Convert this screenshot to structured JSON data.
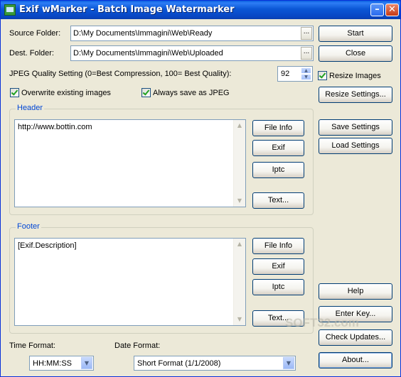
{
  "window": {
    "title": "Exif wMarker - Batch Image Watermarker",
    "minimize_glyph": "–",
    "close_glyph": "✕"
  },
  "source": {
    "label": "Source Folder:",
    "value": "D:\\My Documents\\Immagini\\Web\\Ready",
    "browse": "..."
  },
  "dest": {
    "label": "Dest. Folder:",
    "value": "D:\\My Documents\\Immagini\\Web\\Uploaded",
    "browse": "..."
  },
  "quality": {
    "label": "JPEG Quality Setting (0=Best Compression, 100= Best Quality):",
    "value": "92",
    "up": "▲",
    "down": "▼"
  },
  "options": {
    "overwrite": "Overwrite existing images",
    "always_jpeg": "Always save as JPEG",
    "resize": "Resize Images"
  },
  "header": {
    "title": "Header",
    "text": "http://www.bottin.com",
    "buttons": {
      "file_info": "File Info",
      "exif": "Exif",
      "iptc": "Iptc",
      "text": "Text..."
    }
  },
  "footer": {
    "title": "Footer",
    "text": "[Exif.Description]",
    "buttons": {
      "file_info": "File Info",
      "exif": "Exif",
      "iptc": "Iptc",
      "text": "Text..."
    }
  },
  "scroll": {
    "up": "▲",
    "down": "▼"
  },
  "time_format": {
    "label": "Time Format:",
    "value": "HH:MM:SS",
    "arrow": "▼"
  },
  "date_format": {
    "label": "Date Format:",
    "value": "Short Format (1/1/2008)",
    "arrow": "▼"
  },
  "side_buttons": {
    "start": "Start",
    "close": "Close",
    "resize_settings": "Resize Settings...",
    "save_settings": "Save Settings",
    "load_settings": "Load Settings",
    "help": "Help",
    "enter_key": "Enter Key...",
    "check_updates": "Check Updates...",
    "about": "About..."
  },
  "watermark": "SOFT32.com"
}
